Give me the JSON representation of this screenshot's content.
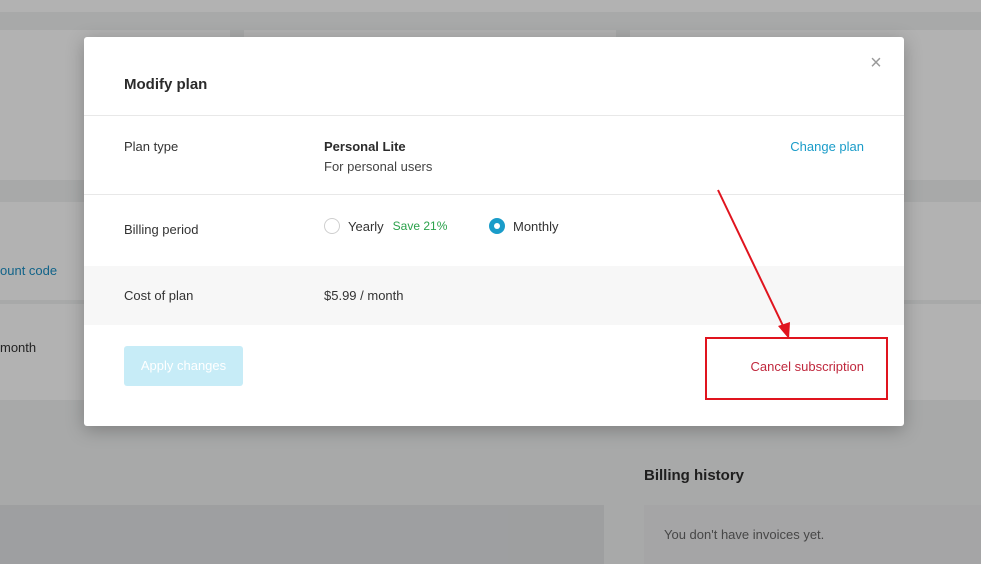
{
  "background": {
    "discount_link": "ount code",
    "month_text": "month",
    "billing_history_title": "Billing history",
    "invoices_empty": "You don't have invoices yet."
  },
  "modal": {
    "title": "Modify plan",
    "close_glyph": "×",
    "plan_type": {
      "label": "Plan type",
      "plan_name": "Personal Lite",
      "plan_description": "For personal users",
      "change_link": "Change plan"
    },
    "billing_period": {
      "label": "Billing period",
      "options": [
        {
          "label": "Yearly",
          "badge": "Save 21%",
          "selected": false
        },
        {
          "label": "Monthly",
          "selected": true
        }
      ]
    },
    "cost": {
      "label": "Cost of plan",
      "value": "$5.99 / month"
    },
    "apply_button": "Apply changes",
    "cancel_link": "Cancel subscription"
  },
  "colors": {
    "accent": "#1a9cc9",
    "danger": "#c0283d",
    "save_green": "#2aa14a",
    "annotation_red": "#e0141e"
  }
}
